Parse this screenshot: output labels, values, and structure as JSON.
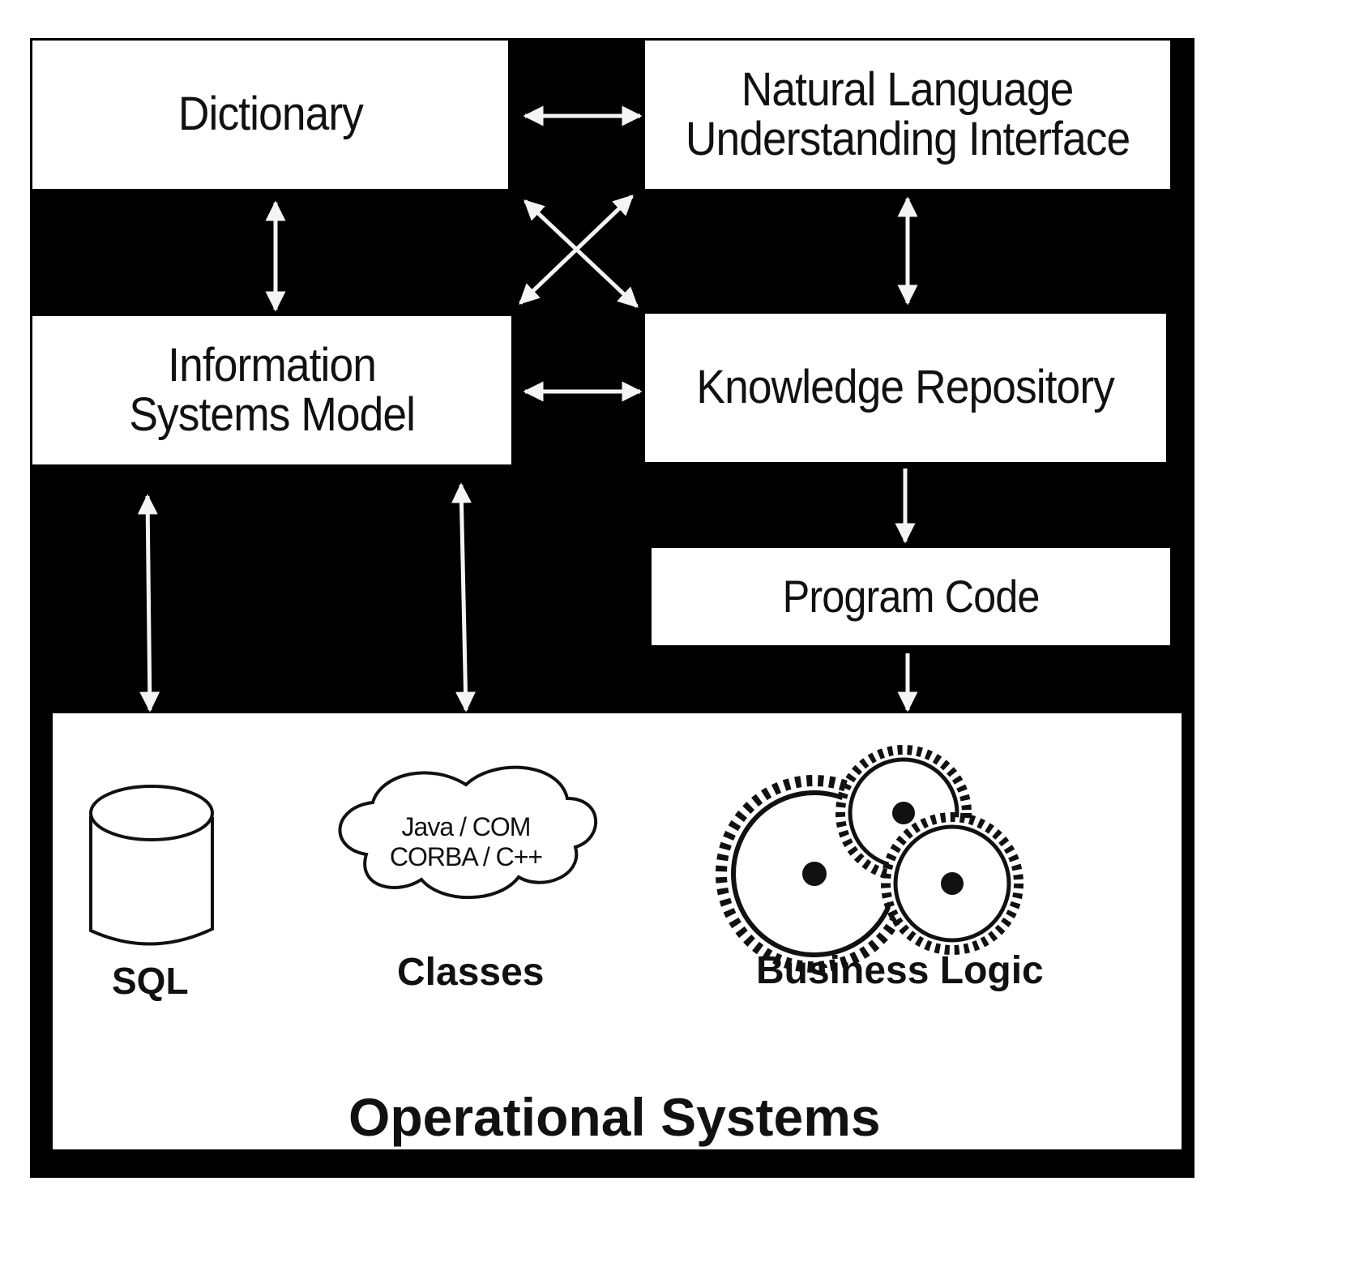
{
  "diagram": {
    "boxes": {
      "dictionary": "Dictionary",
      "nlu_line1": "Natural Language",
      "nlu_line2": "Understanding Interface",
      "ism_line1": "Information",
      "ism_line2": "Systems Model",
      "knowledge_repository": "Knowledge Repository",
      "program_code": "Program Code"
    },
    "operational_systems": {
      "title": "Operational Systems",
      "components": [
        {
          "label": "SQL",
          "icon": "database-cylinder-icon"
        },
        {
          "label": "Classes",
          "icon": "cloud-icon",
          "cloud_line1": "Java / COM",
          "cloud_line2": "CORBA / C++"
        },
        {
          "label": "Business Logic",
          "icon": "gears-icon"
        }
      ]
    },
    "connections": [
      {
        "from": "Dictionary",
        "to": "Natural Language Understanding Interface",
        "direction": "bidirectional"
      },
      {
        "from": "Dictionary",
        "to": "Information Systems Model",
        "direction": "bidirectional"
      },
      {
        "from": "Dictionary",
        "to": "Knowledge Repository",
        "direction": "bidirectional"
      },
      {
        "from": "Information Systems Model",
        "to": "Natural Language Understanding Interface",
        "direction": "bidirectional"
      },
      {
        "from": "Information Systems Model",
        "to": "Knowledge Repository",
        "direction": "bidirectional"
      },
      {
        "from": "Natural Language Understanding Interface",
        "to": "Knowledge Repository",
        "direction": "bidirectional"
      },
      {
        "from": "Knowledge Repository",
        "to": "Program Code",
        "direction": "forward"
      },
      {
        "from": "Program Code",
        "to": "Business Logic",
        "direction": "forward"
      },
      {
        "from": "Information Systems Model",
        "to": "SQL",
        "direction": "bidirectional"
      },
      {
        "from": "Information Systems Model",
        "to": "Classes",
        "direction": "bidirectional"
      }
    ]
  }
}
